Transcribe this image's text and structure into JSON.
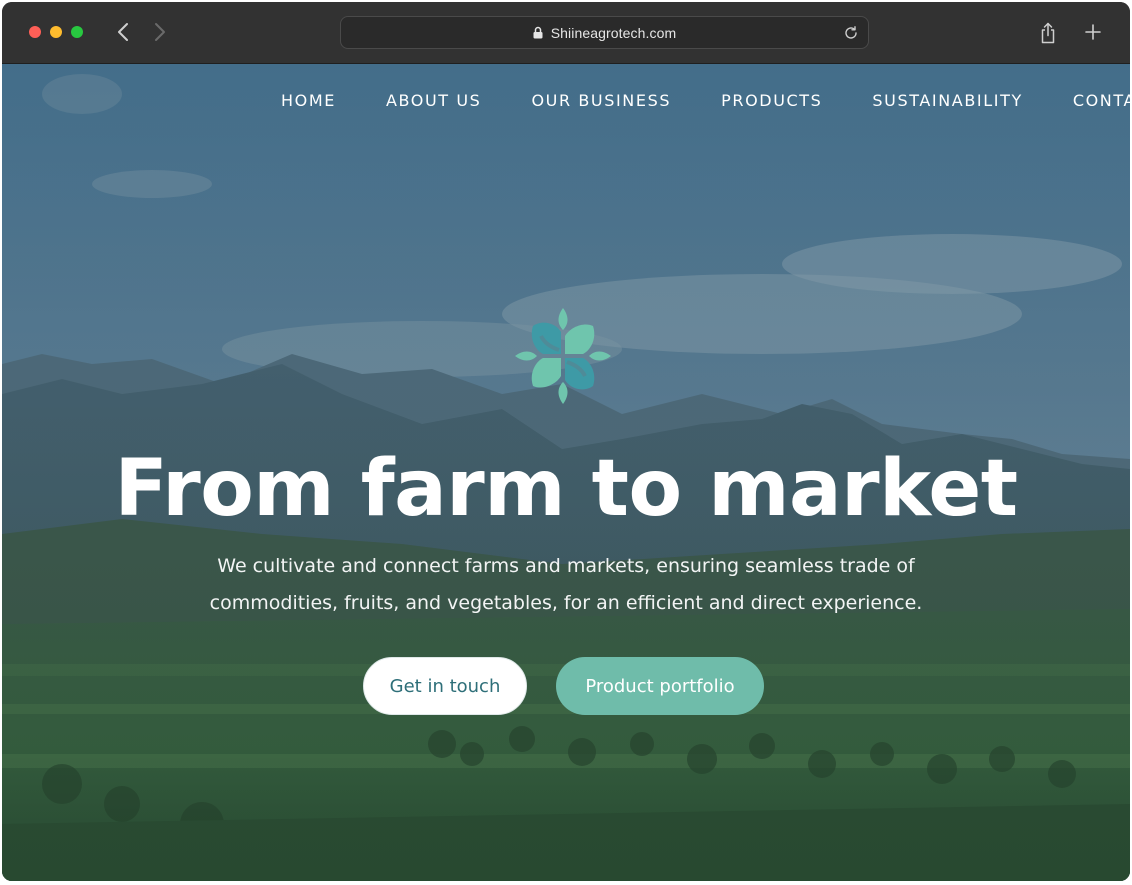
{
  "browser": {
    "url": "Shiineagrotech.com",
    "icons": [
      "back-icon",
      "forward-icon",
      "lock-icon",
      "reload-icon",
      "share-icon",
      "new-tab-icon"
    ]
  },
  "nav": {
    "items": [
      "HOME",
      "ABOUT US",
      "OUR BUSINESS",
      "PRODUCTS",
      "SUSTAINABILITY",
      "CONTA"
    ]
  },
  "hero": {
    "headline": "From farm to market",
    "subtext": "We cultivate and connect farms and markets, ensuring seamless trade of commodities, fruits, and vegetables, for an efficient and direct experience.",
    "buttons": {
      "touch": "Get in touch",
      "portfolio": "Product portfolio"
    }
  },
  "colors": {
    "accent": "#6fbcaa",
    "logo_teal": "#3e9aa6",
    "logo_green": "#6fc5ad",
    "chrome": "#323232"
  }
}
